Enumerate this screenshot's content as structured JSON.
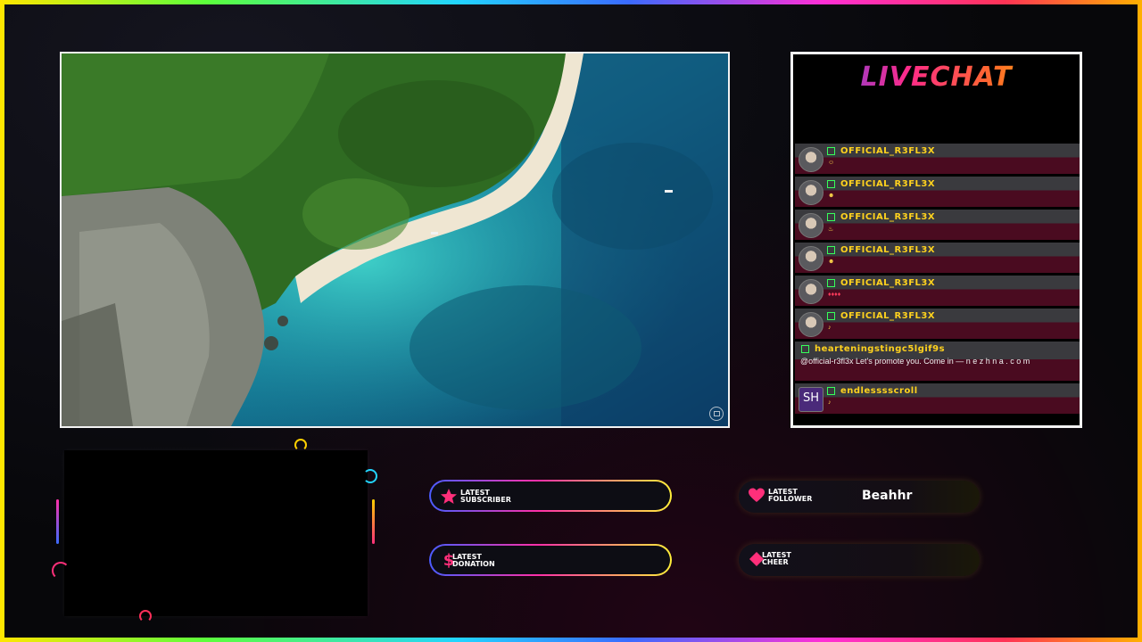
{
  "chat": {
    "title": "LIVECHAT",
    "messages": [
      {
        "user": "OFFICIAL_R3FL3X",
        "text": "☺"
      },
      {
        "user": "OFFICIAL_R3FL3X",
        "text": "☻"
      },
      {
        "user": "OFFICIAL_R3FL3X",
        "text": "♨"
      },
      {
        "user": "OFFICIAL_R3FL3X",
        "text": "☻"
      },
      {
        "user": "OFFICIAL_R3FL3X",
        "text": "♦♦♦♦"
      },
      {
        "user": "OFFICIAL_R3FL3X",
        "text": "♪"
      },
      {
        "user": "hearteningstingc5lgif9s",
        "text": "@official-r3fl3x Let's promote you. Come in — n e z h n a . c o m"
      },
      {
        "user": "endlesssscroll",
        "avatar_text": "SH",
        "text": "♪"
      }
    ]
  },
  "alerts": {
    "subscriber": {
      "label_line1": "LATEST",
      "label_line2": "SUBSCRIBER",
      "value": ""
    },
    "follower": {
      "label_line1": "LATEST",
      "label_line2": "FOLLOWER",
      "value": "Beahhr"
    },
    "donation": {
      "label_line1": "LATEST",
      "label_line2": "DONATION",
      "value": ""
    },
    "cheer": {
      "label_line1": "LATEST",
      "label_line2": "CHEER",
      "value": ""
    }
  },
  "colors": {
    "username": "#ffd21e",
    "mod_badge": "#37ff5a",
    "chat_bar": "#4a0b20",
    "accent_pink": "#ff2f7a"
  },
  "icons": {
    "subscriber": "star-icon",
    "follower": "heart-icon",
    "donation": "dollar-icon",
    "cheer": "diamond-icon"
  }
}
